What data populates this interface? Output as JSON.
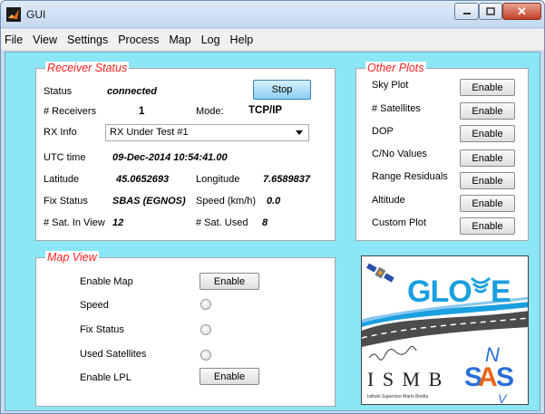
{
  "window": {
    "title": "GUI"
  },
  "menu": [
    "File",
    "View",
    "Settings",
    "Process",
    "Map",
    "Log",
    "Help"
  ],
  "receiver_status": {
    "title": "Receiver Status",
    "status_label": "Status",
    "status_value": "connected",
    "stop_label": "Stop",
    "receivers_label": "# Receivers",
    "receivers_value": "1",
    "mode_label": "Mode:",
    "mode_value": "TCP/IP",
    "rxinfo_label": "RX Info",
    "rxinfo_value": "RX Under Test #1",
    "utc_label": "UTC time",
    "utc_value": "09-Dec-2014 10:54:41.00",
    "lat_label": "Latitude",
    "lat_value": "45.0652693",
    "lon_label": "Longitude",
    "lon_value": "7.6589837",
    "fix_label": "Fix Status",
    "fix_value": "SBAS (EGNOS)",
    "speed_label": "Speed (km/h)",
    "speed_value": "0.0",
    "sat_view_label": "# Sat. In View",
    "sat_view_value": "12",
    "sat_used_label": "# Sat. Used",
    "sat_used_value": "8"
  },
  "other_plots": {
    "title": "Other Plots",
    "items": [
      {
        "label": "Sky Plot",
        "button": "Enable"
      },
      {
        "label": "# Satellites",
        "button": "Enable"
      },
      {
        "label": "DOP",
        "button": "Enable"
      },
      {
        "label": "C/No Values",
        "button": "Enable"
      },
      {
        "label": "Range Residuals",
        "button": "Enable"
      },
      {
        "label": "Altitude",
        "button": "Enable"
      },
      {
        "label": "Custom Plot",
        "button": "Enable"
      }
    ]
  },
  "map_view": {
    "title": "Map View",
    "enable_map_label": "Enable Map",
    "enable_map_button": "Enable",
    "speed_label": "Speed",
    "fix_label": "Fix Status",
    "used_sat_label": "Used Satellites",
    "lpl_label": "Enable LPL",
    "lpl_button": "Enable"
  },
  "logos": {
    "glove": "GLOVE",
    "ismb": "I S M B",
    "ismb_sub": "Istituto Superiore Mario Boella",
    "sas": "SAS",
    "sas_n": "N",
    "sas_v": "V"
  },
  "colors": {
    "background": "#8be6f5",
    "panel_title": "#ff2020",
    "stop_button": "#8ccdf3"
  }
}
